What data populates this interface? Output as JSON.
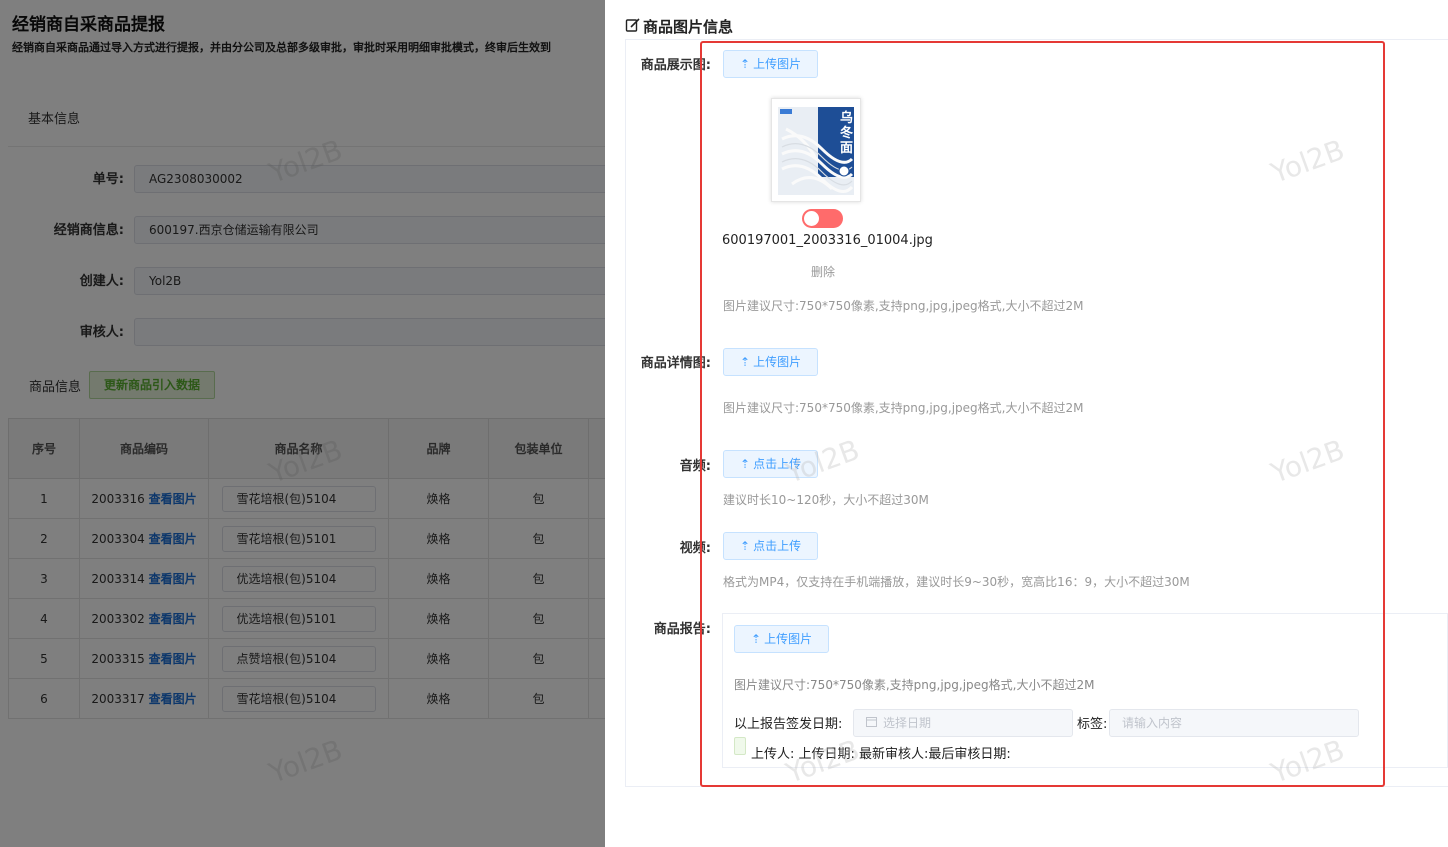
{
  "background": {
    "title": "经销商自采商品提报",
    "description": "经销商自采商品通过导入方式进行提报，并由分公司及总部多级审批，审批时采用明细审批模式，终审后生效到",
    "section_basic": "基本信息",
    "fields": [
      {
        "label": "单号:",
        "value": "AG2308030002"
      },
      {
        "label": "经销商信息:",
        "value": "600197.西京仓储运输有限公司"
      },
      {
        "label": "创建人:",
        "value": "Yol2B"
      },
      {
        "label": "审核人:",
        "value": ""
      }
    ],
    "section_products": "商品信息",
    "update_button": "更新商品引入数据",
    "table": {
      "headers": [
        "序号",
        "商品编码",
        "商品名称",
        "品牌",
        "包装单位"
      ],
      "view_image_label": "查看图片",
      "rows": [
        {
          "no": "1",
          "code": "2003316",
          "name": "雪花培根(包)5104",
          "brand": "焕格",
          "unit": "包"
        },
        {
          "no": "2",
          "code": "2003304",
          "name": "雪花培根(包)5101",
          "brand": "焕格",
          "unit": "包"
        },
        {
          "no": "3",
          "code": "2003314",
          "name": "优选培根(包)5104",
          "brand": "焕格",
          "unit": "包"
        },
        {
          "no": "4",
          "code": "2003302",
          "name": "优选培根(包)5101",
          "brand": "焕格",
          "unit": "包"
        },
        {
          "no": "5",
          "code": "2003315",
          "name": "点赞培根(包)5104",
          "brand": "焕格",
          "unit": "包"
        },
        {
          "no": "6",
          "code": "2003317",
          "name": "雪花培根(包)5104",
          "brand": "焕格",
          "unit": "包"
        }
      ]
    },
    "watermark": "Yol2B"
  },
  "drawer": {
    "title": "商品图片信息",
    "title_icon": "edit-icon",
    "display_image": {
      "label": "商品展示图:",
      "upload_label": "上传图片",
      "thumbnail_text": "乌冬面",
      "filename": "600197001_2003316_01004.jpg",
      "delete_label": "删除",
      "hint": "图片建议尺寸:750*750像素,支持png,jpg,jpeg格式,大小不超过2M"
    },
    "detail_image": {
      "label": "商品详情图:",
      "upload_label": "上传图片",
      "hint": "图片建议尺寸:750*750像素,支持png,jpg,jpeg格式,大小不超过2M"
    },
    "audio": {
      "label": "音频:",
      "upload_label": "点击上传",
      "hint": "建议时长10~120秒，大小不超过30M"
    },
    "video": {
      "label": "视频:",
      "upload_label": "点击上传",
      "hint": "格式为MP4，仅支持在手机端播放，建议时长9~30秒，宽高比16：9，大小不超过30M"
    },
    "report": {
      "label": "商品报告:",
      "upload_label": "上传图片",
      "hint": "图片建议尺寸:750*750像素,支持png,jpg,jpeg格式,大小不超过2M",
      "date_label": "以上报告签发日期:",
      "date_placeholder": "选择日期",
      "tag_label": "标签:",
      "tag_placeholder": "请输入内容",
      "meta": "上传人: 上传日期: 最新审核人:最后审核日期:"
    }
  },
  "colors": {
    "accent": "#409eff",
    "highlight_frame": "#e53935",
    "toggle_off": "#ff6b6b",
    "green_button": "#5bb031"
  }
}
